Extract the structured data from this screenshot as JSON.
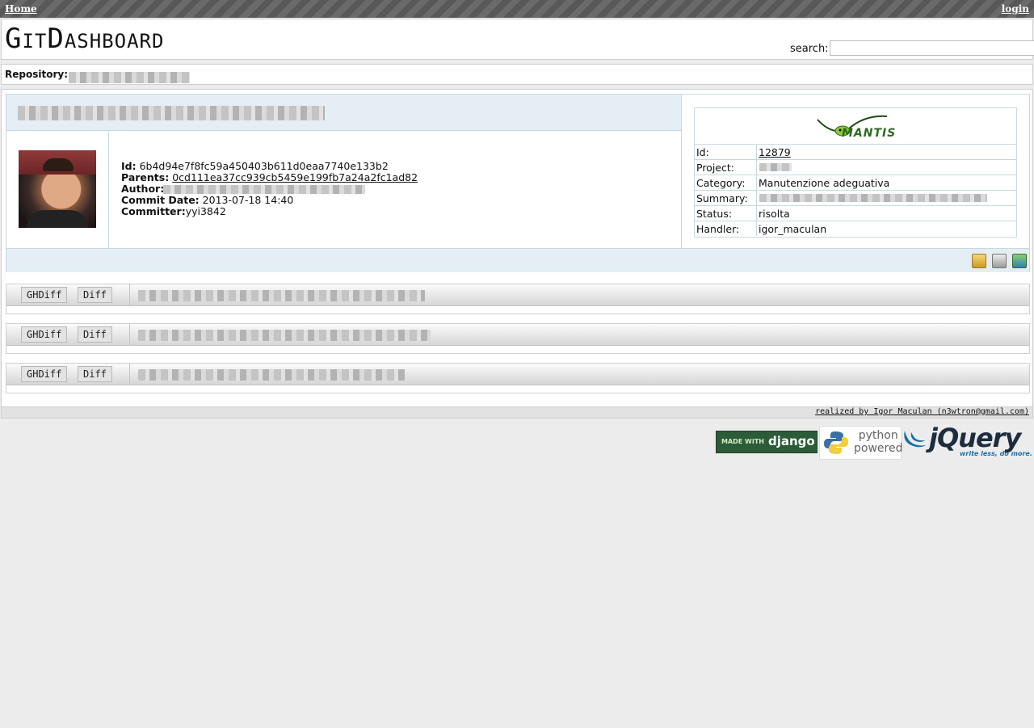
{
  "nav": {
    "home": "Home",
    "login": "login"
  },
  "header": {
    "logo": "GitDashboard",
    "search_label": "search:",
    "search_value": ""
  },
  "repository": {
    "label": "Repository:"
  },
  "commit": {
    "id_label": "Id:",
    "id": "6b4d94e7f8fc59a450403b611d0eaa7740e133b2",
    "parents_label": "Parents:",
    "parents": "0cd111ea37cc939cb5459e199fb7a24a2fc1ad82",
    "author_label": "Author:",
    "commit_date_label": "Commit Date:",
    "commit_date": "2013-07-18 14:40",
    "committer_label": "Committer:",
    "committer": "yyi3842"
  },
  "mantis": {
    "logo_text": "MANTIS",
    "rows": [
      {
        "key": "Id:",
        "value": "12879",
        "link": true
      },
      {
        "key": "Project:",
        "value": ""
      },
      {
        "key": "Category:",
        "value": "Manutenzione adeguativa"
      },
      {
        "key": "Summary:",
        "value": ""
      },
      {
        "key": "Status:",
        "value": "risolta"
      },
      {
        "key": "Handler:",
        "value": "igor_maculan"
      }
    ]
  },
  "diff_buttons": {
    "ghdiff": "GHDiff",
    "diff": "Diff"
  },
  "footer": {
    "credit": "realized by Igor Maculan (n3wtron@gmail.com)"
  },
  "badges": {
    "django_small": "MADE WITH",
    "django_big": "django",
    "python_line1": "python",
    "python_line2": "powered",
    "jquery_word": "jQuery",
    "jquery_tag": "write less, do more."
  },
  "colors": {
    "accent_blue": "#e4eef4",
    "django_green": "#2b5b39",
    "topbar": "#6a6a6a"
  }
}
